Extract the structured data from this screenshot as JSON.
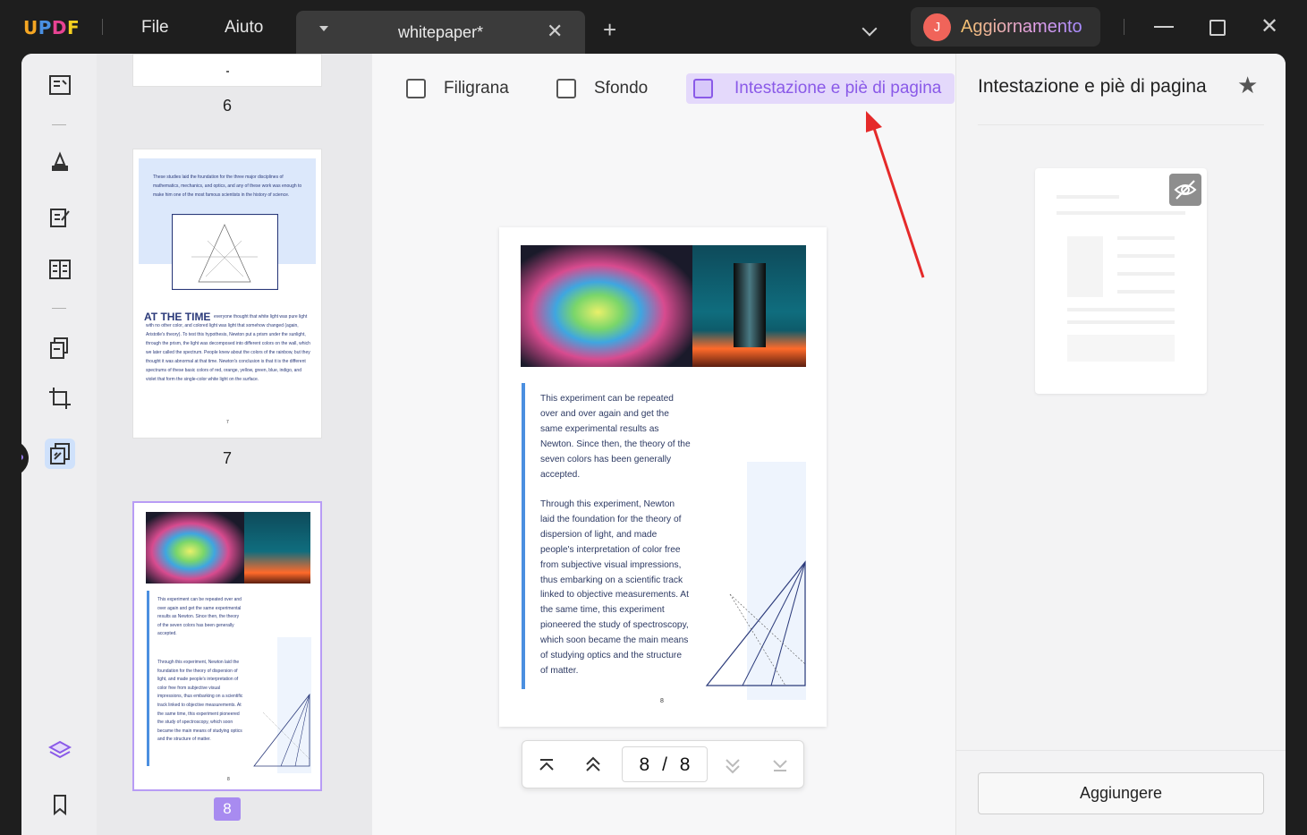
{
  "app": {
    "logo": {
      "u": "U",
      "p": "P",
      "d": "D",
      "f": "F"
    },
    "menu": {
      "file": "File",
      "help": "Aiuto"
    },
    "tab": {
      "title": "whitepaper*",
      "close": "✕",
      "new": "+"
    },
    "upgrade": {
      "avatar_letter": "J",
      "label": "Aggiornamento"
    },
    "window_close": "✕"
  },
  "toolbar": {
    "watermark": "Filigrana",
    "background": "Sfondo",
    "header_footer": "Intestazione e piè di pagina"
  },
  "thumbnails": {
    "pages": [
      {
        "number": "6",
        "selected": false
      },
      {
        "number": "7",
        "selected": false
      },
      {
        "number": "8",
        "selected": true
      }
    ],
    "page7": {
      "intro": "These studies laid the foundation for the three major disciplines of mathematics, mechanics, and optics, and any of these work was enough to make him one of the most famous scientists in the history of science.",
      "heading": "AT THE TIME",
      "body": "everyone thought that white light was pure light with no other color, and colored light was light that somehow changed (again, Aristotle's theory). To test this hypothesis, Newton put a prism under the sunlight, through the prism, the light was decomposed into different colors on the wall, which we later called the spectrum. People knew about the colors of the rainbow, but they thought it was abnormal at that time. Newton's conclusion is that it is the different spectrums of these basic colors of red, orange, yellow, green, blue, indigo, and violet that form the single-color white light on the surface.",
      "footer": "7"
    }
  },
  "document": {
    "paragraph1": "This experiment can be repeated over and over again and get the same experimental results as Newton. Since then, the theory of the seven colors has been generally accepted.",
    "paragraph2": "Through this experiment, Newton laid the foundation for the theory of dispersion of light, and made people's interpretation of color free from subjective visual impressions, thus embarking on a scientific track linked to objective measurements. At the same time, this experiment pioneered the study of spectroscopy, which soon became the main means of studying optics and the structure of matter.",
    "page_number": "8"
  },
  "navigation": {
    "current_page": "8",
    "separator": "/",
    "total_pages": "8"
  },
  "right_panel": {
    "title": "Intestazione e piè di pagina",
    "add_button": "Aggiungere"
  },
  "colors": {
    "accent": "#8a5ae8",
    "accent_bg": "#e4d9fb",
    "annotation_arrow": "#e52a2a",
    "titlebar": "#1e1e1e"
  }
}
